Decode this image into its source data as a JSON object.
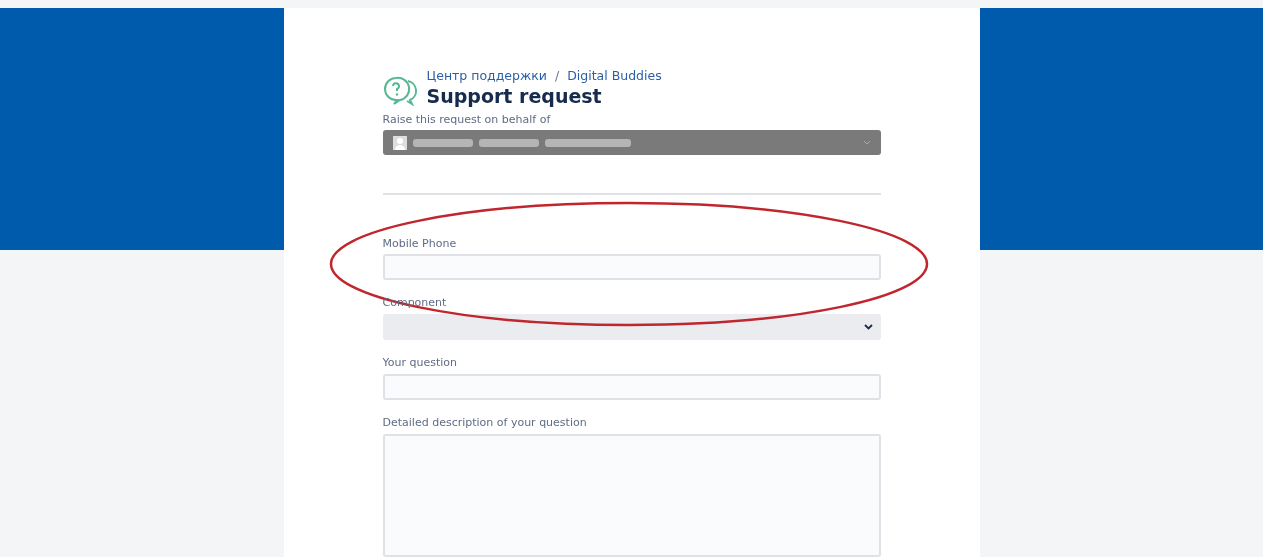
{
  "breadcrumbs": [
    {
      "label": "Центр поддержки"
    },
    {
      "label": "Digital Buddies"
    }
  ],
  "breadcrumb_separator": "/",
  "title": "Support request",
  "on_behalf": {
    "label": "Raise this request on behalf of"
  },
  "fields": [
    {
      "kind": "input",
      "label": "Mobile Phone"
    },
    {
      "kind": "select",
      "label": "Component"
    },
    {
      "kind": "input",
      "label": "Your question"
    },
    {
      "kind": "textarea",
      "label": "Detailed description of your question"
    }
  ]
}
